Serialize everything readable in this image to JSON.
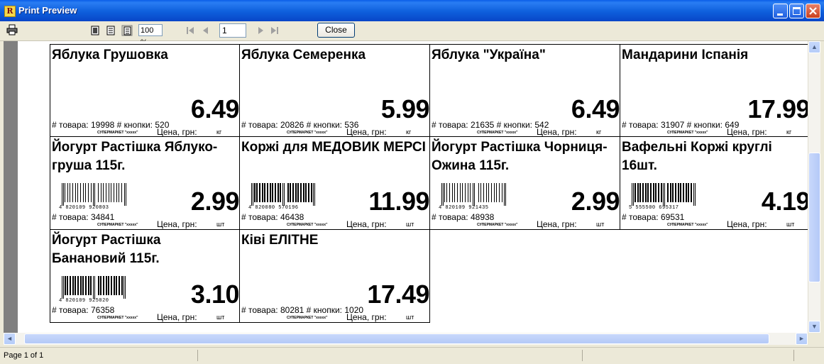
{
  "window": {
    "title": "Print Preview",
    "app_icon_letter": "R"
  },
  "toolbar": {
    "zoom": "100 %",
    "page_number": "1",
    "close_label": "Close"
  },
  "labels": [
    {
      "name": "Яблука Грушовка",
      "price": "6.49",
      "footer": "# товара: 19998 # кнопки: 520",
      "currency": "Цена, грн:",
      "unit": "кг",
      "store": "СУПЕРМАРКЕТ \"xxxxx\"",
      "barcode": ""
    },
    {
      "name": "Яблука Семеренка",
      "price": "5.99",
      "footer": "# товара: 20826 # кнопки: 536",
      "currency": "Цена, грн:",
      "unit": "кг",
      "store": "СУПЕРМАРКЕТ \"xxxxx\"",
      "barcode": ""
    },
    {
      "name": "Яблука \"Україна\"",
      "price": "6.49",
      "footer": "# товара: 21635 # кнопки: 542",
      "currency": "Цена, грн:",
      "unit": "кг",
      "store": "СУПЕРМАРКЕТ \"xxxxx\"",
      "barcode": ""
    },
    {
      "name": "Мандарини Іспанія",
      "price": "17.99",
      "footer": "# товара: 31907 # кнопки: 649",
      "currency": "Цена, грн:",
      "unit": "кг",
      "store": "СУПЕРМАРКЕТ \"xxxxx\"",
      "barcode": ""
    },
    {
      "name": "Йогурт Растішка Яблуко-груша 115г.",
      "price": "2.99",
      "footer": "# товара: 34841",
      "currency": "Цена, грн:",
      "unit": "шт",
      "store": "СУПЕРМАРКЕТ \"xxxxx\"",
      "barcode": "4 820109 920803"
    },
    {
      "name": "Коржі для МЕДОВИК МЕРСІ",
      "price": "11.99",
      "footer": "# товара: 46438",
      "currency": "Цена, грн:",
      "unit": "шт",
      "store": "СУПЕРМАРКЕТ \"xxxxx\"",
      "barcode": "4 820080 570196"
    },
    {
      "name": "Йогурт Растішка Чорниця-Ожина 115г.",
      "price": "2.99",
      "footer": "# товара: 48938",
      "currency": "Цена, грн:",
      "unit": "шт",
      "store": "СУПЕРМАРКЕТ \"xxxxx\"",
      "barcode": "4 820109 921435"
    },
    {
      "name": "Вафельні Коржі круглі 16шт.",
      "price": "4.19",
      "footer": "# товара: 69531",
      "currency": "Цена, грн:",
      "unit": "шт",
      "store": "СУПЕРМАРКЕТ \"xxxxx\"",
      "barcode": "5 555500 695317"
    },
    {
      "name": "Йогурт Растішка Банановий 115г.",
      "price": "3.10",
      "footer": "# товара: 76358",
      "currency": "Цена, грн:",
      "unit": "шт",
      "store": "СУПЕРМАРКЕТ \"xxxxx\"",
      "barcode": "4 820109 925020"
    },
    {
      "name": "Ківі ЕЛІТНЕ",
      "price": "17.49",
      "footer": "# товара: 80281 # кнопки: 1020",
      "currency": "Цена, грн:",
      "unit": "шт",
      "store": "СУПЕРМАРКЕТ \"xxxxx\"",
      "barcode": ""
    }
  ],
  "status": {
    "page_info": "Page 1 of 1"
  }
}
